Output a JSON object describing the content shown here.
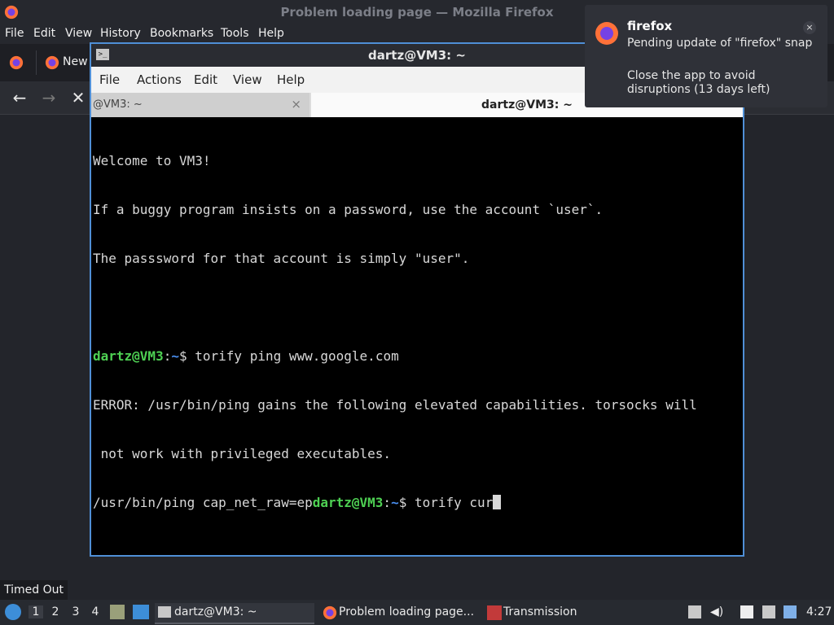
{
  "firefox": {
    "title": "Problem loading page — Mozilla Firefox",
    "menu": [
      "File",
      "Edit",
      "View",
      "History",
      "Bookmarks",
      "Tools",
      "Help"
    ],
    "tab_label": "New"
  },
  "terminal": {
    "title": "dartz@VM3: ~",
    "menu": [
      "File",
      "Actions",
      "Edit",
      "View",
      "Help"
    ],
    "tabs": [
      {
        "label": "@VM3: ~",
        "close": "×"
      },
      {
        "label": "dartz@VM3: ~"
      }
    ],
    "lines": [
      "Welcome to VM3!",
      "If a buggy program insists on a password, use the account `user`.",
      "The passsword for that account is simply \"user\".",
      "",
      "ERROR: /usr/bin/ping gains the following elevated capabilities. torsocks will",
      " not work with privileged executables."
    ],
    "prompt1": {
      "user_host": "dartz@VM3",
      "sep": ":",
      "dir": "~",
      "sym": "$",
      "cmd": " torify ping www.google.com"
    },
    "line7_prefix": "/usr/bin/ping cap_net_raw=ep",
    "prompt2": {
      "user_host": "dartz@VM3",
      "sep": ":",
      "dir": "~",
      "sym": "$",
      "cmd": " torify cur"
    }
  },
  "notification": {
    "app": "firefox",
    "summary": "Pending update of \"firefox\" snap",
    "body": "Close the app to avoid disruptions (13 days left)",
    "close": "×"
  },
  "tooltip": "Timed Out",
  "taskbar": {
    "workspaces": [
      "1",
      "2",
      "3",
      "4"
    ],
    "tasks": [
      "dartz@VM3: ~",
      "Problem loading page...",
      "Transmission"
    ],
    "clock": "4:27"
  },
  "colors": {
    "accent": "#4f8fd6",
    "prompt_user": "#4ed053",
    "prompt_dir": "#4a8ff0"
  },
  "icons": [
    "firefox-icon",
    "back-icon",
    "forward-icon",
    "stop-icon",
    "terminal-icon",
    "start-menu-icon",
    "volume-icon",
    "network-icon",
    "clipboard-icon"
  ]
}
